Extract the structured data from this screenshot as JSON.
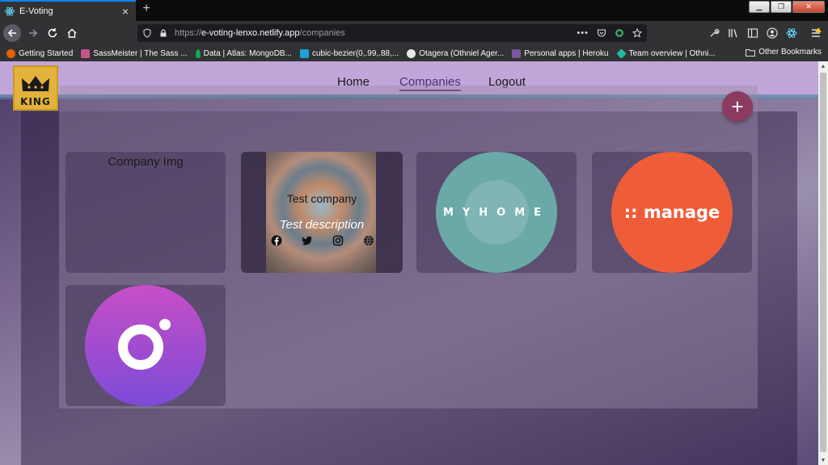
{
  "browser": {
    "tab_title": "E-Voting",
    "new_tab_icon": "+",
    "url": {
      "scheme": "https://",
      "domain": "e-voting-lenxo.netlify.app",
      "path": "/companies"
    },
    "bookmarks": [
      {
        "label": "Getting Started",
        "color": "#e66000"
      },
      {
        "label": "SassMeister | The Sass ...",
        "color": "#c6538c"
      },
      {
        "label": "Data | Atlas: MongoDB...",
        "color": "#13aa52"
      },
      {
        "label": "cubic-bezier(0,.99,.88,...",
        "color": "#1aa3d9"
      },
      {
        "label": "Otagera (Othniel Ager...",
        "color": "#e8e8e8"
      },
      {
        "label": "Personal apps | Heroku",
        "color": "#79589f"
      },
      {
        "label": "Team overview | Othni...",
        "color": "#21b9a3"
      }
    ],
    "other_bookmarks": "Other Bookmarks"
  },
  "site": {
    "logo_text": "KING",
    "nav": {
      "home": "Home",
      "companies": "Companies",
      "logout": "Logout"
    },
    "add_icon": "+"
  },
  "cards": {
    "placeholder_label": "Company Img",
    "test_company": {
      "name": "Test company",
      "description": "Test description"
    },
    "myhome_logo": "MYHOME",
    "manage_logo": ":: manage"
  }
}
